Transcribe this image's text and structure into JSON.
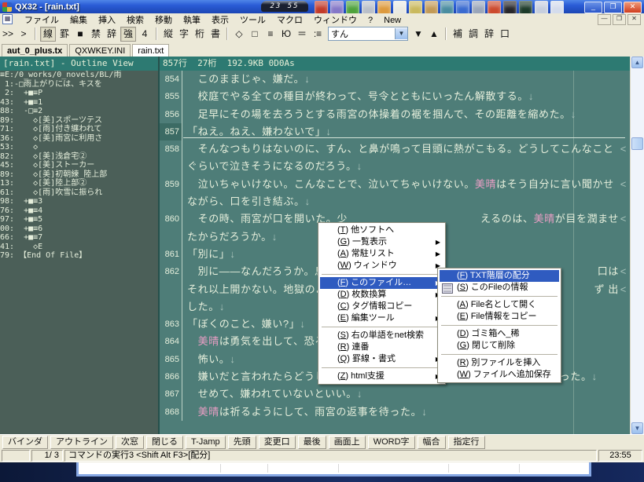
{
  "window": {
    "title": "QX32 - [rain.txt]",
    "clock": "23 55",
    "controls": {
      "minimize": "_",
      "restore": "❐",
      "close": "✕"
    },
    "mdi_controls": {
      "minimize": "—",
      "restore": "❐",
      "close": "✕"
    }
  },
  "titlebar_launchers": [
    {
      "name": "app-red-icon",
      "color": "#c23b2a"
    },
    {
      "name": "app-search-icon",
      "color": "#8578c8"
    },
    {
      "name": "app-green-flower-icon",
      "color": "#4ea23c"
    },
    {
      "name": "app-silver-swoosh-icon",
      "color": "#b9bfc9"
    },
    {
      "name": "folder-orange-icon",
      "color": "#dd9a3d"
    },
    {
      "name": "document-white-icon",
      "color": "#e9e9e2"
    },
    {
      "name": "app-khaki-icon",
      "color": "#c9b95e"
    },
    {
      "name": "folder-tan-icon",
      "color": "#c29a57"
    },
    {
      "name": "globe-teal-icon",
      "color": "#4a8da0"
    },
    {
      "name": "browser-e-icon",
      "color": "#3a6bd0"
    },
    {
      "name": "app-steel-icon",
      "color": "#9aa6ba"
    },
    {
      "name": "flag-red-icon",
      "color": "#cc4a2e"
    },
    {
      "name": "chart-black-icon",
      "color": "#27272b"
    },
    {
      "name": "grid-darkgreen-icon",
      "color": "#1d3b2a"
    },
    {
      "name": "windows-stack-icon",
      "color": "#c6cede"
    },
    {
      "name": "mail-envelope-icon",
      "color": "#d4dcec"
    }
  ],
  "menubar": [
    {
      "label": "ファイル"
    },
    {
      "label": "編集"
    },
    {
      "label": "挿入"
    },
    {
      "label": "検索"
    },
    {
      "label": "移動"
    },
    {
      "label": "執筆"
    },
    {
      "label": "表示"
    },
    {
      "label": "ツール"
    },
    {
      "label": "マクロ"
    },
    {
      "label": "ウィンドウ"
    },
    {
      "label": "?"
    },
    {
      "label": "New",
      "u": true
    }
  ],
  "toolbar": {
    "groups": [
      [
        ">>",
        ">"
      ],
      [
        "線",
        "罫",
        "■",
        "禁",
        "辞",
        "強",
        "4"
      ],
      [
        "縦",
        "字",
        "桁",
        "書"
      ],
      [
        "◇",
        "□",
        "≡",
        "Ю",
        "＝",
        ":≡"
      ]
    ],
    "pressed": [
      "線",
      "強"
    ],
    "combo_value": "すん",
    "nav_buttons": [
      "▼",
      "▲"
    ],
    "right_group": [
      "補",
      "調",
      "辞",
      "口"
    ]
  },
  "tabs": [
    {
      "label": "aut_0_plus.tx",
      "bold": true
    },
    {
      "label": "QXWKEY.INI"
    },
    {
      "label": "rain.txt",
      "active": true
    }
  ],
  "outline": {
    "header": "[rain.txt] - Outline View",
    "lines": [
      "≡E:/0_works/0_novels/BL/雨",
      " 1:-□雨上がりには、キスを",
      " 2:  +■≡P",
      "43:  +■≡1",
      "88:  -□≡2",
      "89:    ◇[美]スポーツテス",
      "71:    ◇[雨]付き纏われて",
      "36:    ◇[美]雨宮に利用さ",
      "53:    ◇",
      "82:    ◇[美]浅倉宅②",
      "45:    ◇[美]ストーカー",
      "89:    ◇[美]初朝練_陸上部",
      "13:    ◇[美]陸上部②",
      "61:    ◇[雨]吹雪に振られ",
      "98:  +■≡3",
      "76:  +■≡4",
      "97:  +■≡5",
      "00:  +■≡6",
      "66:  +■≡7",
      "41:    ◇E",
      "79: 【End Of File】"
    ]
  },
  "editor": {
    "header": "857行  27桁  192.9KB 0D0As",
    "rows": [
      {
        "num": "854",
        "parts": [
          [
            "　このままじゃ、嫌だ。",
            ""
          ],
          [
            "↓",
            "mk"
          ]
        ]
      },
      {
        "num": "855",
        "parts": [
          [
            "　校庭でやる全ての種目が終わって、号令とともにいったん解散する。",
            ""
          ],
          [
            "↓",
            "mk"
          ]
        ]
      },
      {
        "num": "856",
        "parts": [
          [
            "　足早にその場を去ろうとする雨宮の体操着の裾を掴んで、その距離を縮めた。",
            ""
          ],
          [
            "↓",
            "mk"
          ]
        ]
      },
      {
        "num": "857",
        "current": true,
        "parts": [
          [
            "「ねえ。ねえ、嫌わないで」",
            ""
          ],
          [
            "↓",
            "mk"
          ]
        ]
      },
      {
        "num": "858",
        "wrap": true,
        "parts": [
          [
            "　そんなつもりはないのに、すん、と鼻が鳴って目頭に熱がこもる。どうしてこんなこと",
            ""
          ]
        ]
      },
      {
        "parts": [
          [
            "ぐらいで泣きそうになるのだろう。",
            ""
          ],
          [
            "↓",
            "mk"
          ]
        ]
      },
      {
        "num": "859",
        "wrap": true,
        "parts": [
          [
            "　泣いちゃいけない。こんなことで、泣いてちゃいけない。",
            ""
          ],
          [
            "美晴",
            "nm"
          ],
          [
            "はそう自分に言い聞かせ",
            ""
          ]
        ]
      },
      {
        "parts": [
          [
            "ながら、口を引き結ぶ。",
            ""
          ],
          [
            "↓",
            "mk"
          ]
        ]
      },
      {
        "num": "860",
        "wrap": true,
        "parts": [
          [
            "　その時、雨宮が口を開いた。少",
            ""
          ]
        ],
        "right": [
          [
            "えるのは、",
            ""
          ],
          [
            "美晴",
            "nm"
          ],
          [
            "が目を潤ませ",
            ""
          ]
        ]
      },
      {
        "parts": [
          [
            "たからだろうか。",
            ""
          ],
          [
            "↓",
            "mk"
          ]
        ]
      },
      {
        "num": "861",
        "parts": [
          [
            "「別に」",
            ""
          ],
          [
            "↓",
            "mk"
          ]
        ]
      },
      {
        "num": "862",
        "wrap": true,
        "parts": [
          [
            "　別に――なんだろうか。息を詰",
            ""
          ]
        ],
        "right": [
          [
            "口は",
            ""
          ]
        ]
      },
      {
        "wrap": true,
        "parts": [
          [
            "それ以上開かない。地獄のような",
            ""
          ]
        ],
        "right": [
          [
            "ず 出",
            ""
          ]
        ]
      },
      {
        "parts": [
          [
            "した。",
            ""
          ],
          [
            "↓",
            "mk"
          ]
        ]
      },
      {
        "num": "863",
        "parts": [
          [
            "「ぼくのこと、嫌い?」",
            ""
          ],
          [
            "↓",
            "mk"
          ]
        ]
      },
      {
        "num": "864",
        "parts": [
          [
            "　",
            ""
          ],
          [
            "美晴",
            "nm"
          ],
          [
            "は勇気を出して、恐る恐る",
            ""
          ]
        ]
      },
      {
        "num": "865",
        "parts": [
          [
            "　怖い。",
            ""
          ],
          [
            "↓",
            "mk"
          ]
        ]
      },
      {
        "num": "866",
        "parts": [
          [
            "　嫌いだと言われたらどうしよう。少なくとも、好かれていないことは確かだった。",
            ""
          ],
          [
            "↓",
            "mk"
          ]
        ]
      },
      {
        "num": "867",
        "parts": [
          [
            "　せめて、嫌われていないといい。",
            ""
          ],
          [
            "↓",
            "mk"
          ]
        ]
      },
      {
        "num": "868",
        "parts": [
          [
            "　",
            ""
          ],
          [
            "美晴",
            "nm"
          ],
          [
            "は祈るようにして、雨宮の返事を待った。",
            ""
          ],
          [
            "↓",
            "mk"
          ]
        ]
      }
    ]
  },
  "context_menu": {
    "items": [
      {
        "key": "T",
        "label": "他ソフトへ"
      },
      {
        "key": "G",
        "label": "一覧表示",
        "arrow": true
      },
      {
        "key": "A",
        "label": "常駐リスト",
        "arrow": true
      },
      {
        "key": "W",
        "label": "ウィンドウ",
        "arrow": true
      },
      {
        "sep": true
      },
      {
        "key": "F",
        "label": "このファイル…",
        "arrow": true,
        "selected": true
      },
      {
        "key": "D",
        "label": "枚数換算",
        "arrow": true
      },
      {
        "key": "C",
        "label": "タグ情報コピー"
      },
      {
        "key": "E",
        "label": "編集ツール",
        "arrow": true
      },
      {
        "sep": true
      },
      {
        "key": "S",
        "label": "右の単語をnet検索"
      },
      {
        "key": "R",
        "label": "連番"
      },
      {
        "key": "Q",
        "label": "罫線・書式",
        "arrow": true
      },
      {
        "sep": true
      },
      {
        "key": "Z",
        "label": "html支援",
        "arrow": true
      }
    ]
  },
  "submenu": {
    "items": [
      {
        "key": "F",
        "label": "TXT階層の配分",
        "selected": true
      },
      {
        "key": "S",
        "label": "このFileの情報",
        "icon": "file-info-icon"
      },
      {
        "sep": true
      },
      {
        "key": "A",
        "label": "File名として開く"
      },
      {
        "key": "E",
        "label": "File情報をコピー"
      },
      {
        "sep": true
      },
      {
        "key": "D",
        "label": "ゴミ箱へ_稀"
      },
      {
        "key": "G",
        "label": "閉じて削除"
      },
      {
        "sep": true
      },
      {
        "key": "R",
        "label": "別ファイルを挿入"
      },
      {
        "key": "W",
        "label": "ファイルへ追加保存"
      }
    ]
  },
  "bottombar": [
    "バインダ",
    "アウトライン",
    "次窓",
    "閉じる",
    "T-Jamp",
    "先頭",
    "変更口",
    "最後",
    "画面上",
    "WORD字",
    "幅合",
    "指定行"
  ],
  "statusbar": {
    "page": "1/ 3",
    "message": "コマンドの実行3 <Shift Alt F3>[配分]",
    "time": "23:55"
  },
  "icons": {
    "submenu_arrow": "▶",
    "scroll_up": "▲",
    "scroll_down": "▼",
    "combo_arrow": "▼",
    "wrap_mark": "<"
  },
  "colors": {
    "editor_bg": "#4e7d78",
    "outline_bg": "#4b5f58",
    "pane_header_bg": "#2d7a72",
    "text": "#e6efdc",
    "name_highlight": "#e89ec4",
    "menu_selection": "#2f5bc0",
    "titlebar_blue": "#2a5cd6",
    "chrome_beige": "#ECE9D8"
  }
}
